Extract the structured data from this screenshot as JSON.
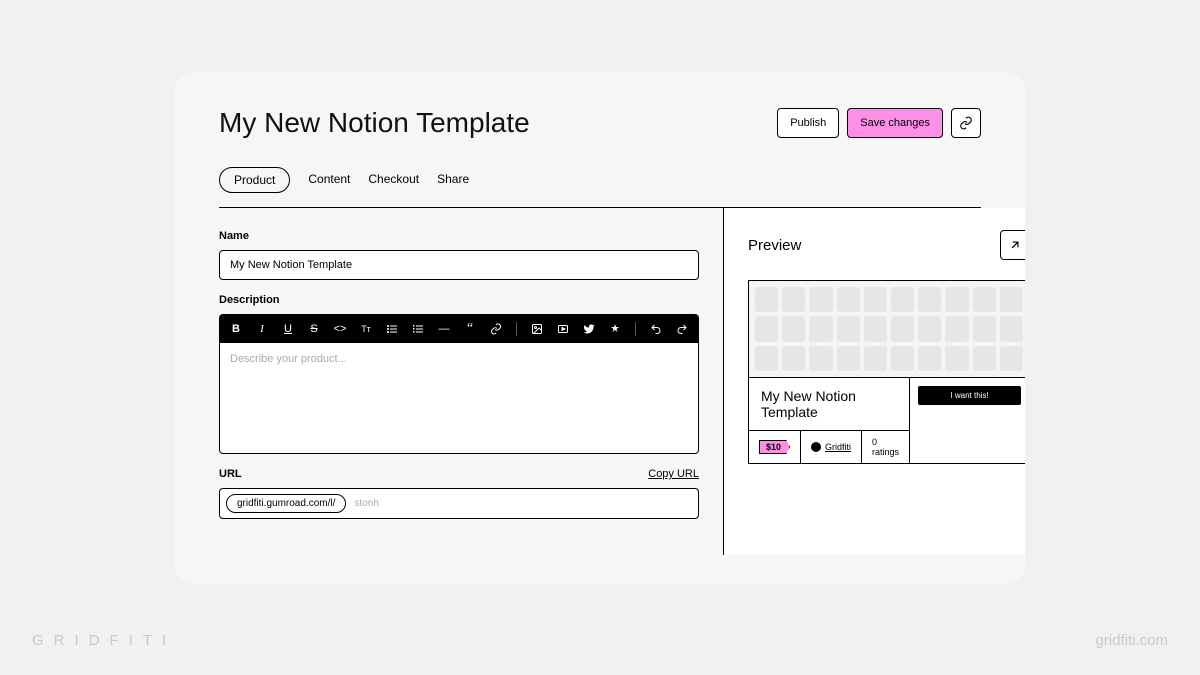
{
  "page_title": "My New Notion Template",
  "actions": {
    "publish": "Publish",
    "save": "Save changes"
  },
  "tabs": [
    "Product",
    "Content",
    "Checkout",
    "Share"
  ],
  "active_tab": 0,
  "form": {
    "name_label": "Name",
    "name_value": "My New Notion Template",
    "description_label": "Description",
    "description_placeholder": "Describe your product...",
    "url_label": "URL",
    "copy_url": "Copy URL",
    "url_base": "gridfiti.gumroad.com/l/",
    "url_slug": "stonh"
  },
  "preview": {
    "heading": "Preview",
    "product_title": "My New Notion Template",
    "price": "$10",
    "author": "Gridfiti",
    "ratings": "0 ratings",
    "buy_button": "I want this!"
  },
  "watermark": {
    "brand": "GRIDFITI",
    "url": "gridfiti.com"
  }
}
